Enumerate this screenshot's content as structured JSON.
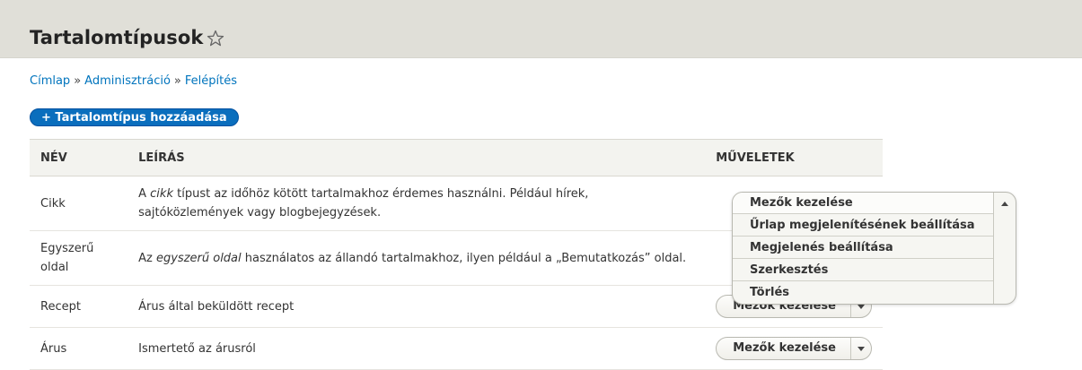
{
  "header": {
    "title": "Tartalomtípusok"
  },
  "breadcrumb": {
    "items": [
      "Címlap",
      "Adminisztráció",
      "Felépítés"
    ],
    "separator": "»"
  },
  "add_button": {
    "label": "+ Tartalomtípus hozzáadása"
  },
  "table": {
    "headers": {
      "name": "NÉV",
      "description": "LEÍRÁS",
      "operations": "MŰVELETEK"
    },
    "rows": [
      {
        "name": "Cikk",
        "desc_prefix": "A ",
        "desc_em": "cikk",
        "desc_suffix": " típust az időhöz kötött tartalmakhoz érdemes használni. Például hírek, sajtóközlemények vagy blogbejegyzések.",
        "op": "Mezők kezelése"
      },
      {
        "name": "Egyszerű oldal",
        "desc_prefix": "Az ",
        "desc_em": "egyszerű oldal",
        "desc_suffix": " használatos az állandó tartalmakhoz, ilyen például a „Bemutatkozás” oldal.",
        "op": "Mezők kezelése"
      },
      {
        "name": "Recept",
        "desc": "Árus által beküldött recept",
        "op": "Mezők kezelése"
      },
      {
        "name": "Árus",
        "desc": "Ismertető az árusról",
        "op": "Mezők kezelése"
      }
    ]
  },
  "open_menu": {
    "items": [
      "Mezők kezelése",
      "Űrlap megjelenítésének beállítása",
      "Megjelenés beállítása",
      "Szerkesztés",
      "Törlés"
    ]
  },
  "colors": {
    "accent": "#0a6ebd",
    "link": "#0074bd",
    "header_bg": "#e0dfd8"
  }
}
